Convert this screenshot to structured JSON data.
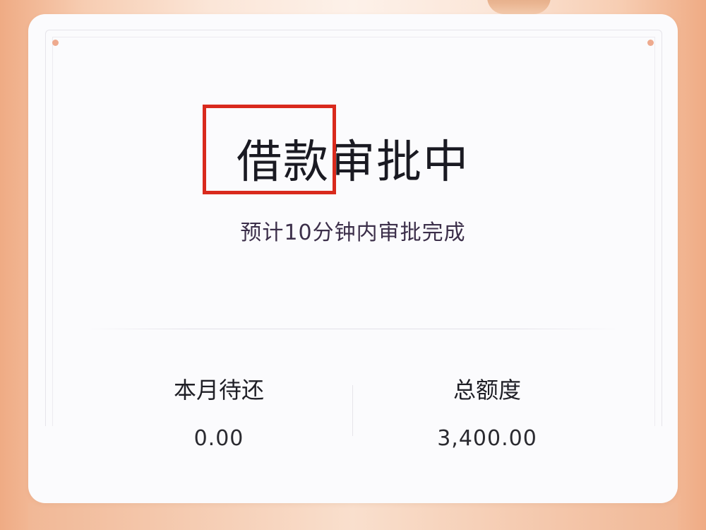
{
  "status_card": {
    "title": "借款审批中",
    "subtitle": "预计10分钟内审批完成"
  },
  "stats": {
    "monthly_due_label": "本月待还",
    "monthly_due_value": "0.00",
    "total_limit_label": "总额度",
    "total_limit_value": "3,400.00"
  },
  "colors": {
    "highlight": "#d92a1d",
    "accent": "#eeaa8e"
  }
}
